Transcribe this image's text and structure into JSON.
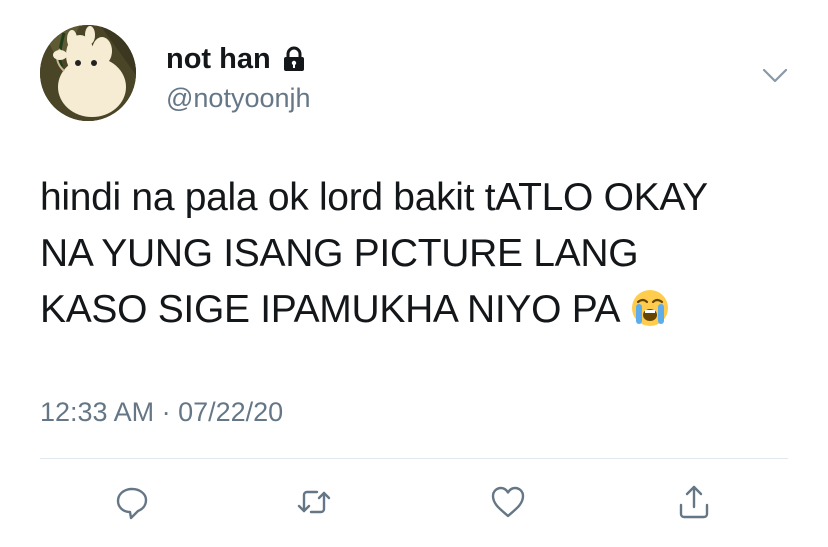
{
  "tweet": {
    "display_name": "not han",
    "handle": "@notyoonjh",
    "text_lines": [
      "hindi na pala ok lord bakit tATLO OKAY",
      "NA YUNG ISANG PICTURE LANG",
      "KASO SIGE IPAMUKHA NIYO PA"
    ],
    "emoji": "loudly-crying-face",
    "timestamp": "12:33 AM · 07/22/20"
  },
  "icons": {
    "verified_lock": "lock-icon",
    "menu": "chevron-down-icon",
    "actions": [
      "reply-icon",
      "retweet-icon",
      "like-icon",
      "share-icon"
    ]
  },
  "colors": {
    "text": "#14171a",
    "secondary": "#657786",
    "divider": "#e1e8ed"
  }
}
